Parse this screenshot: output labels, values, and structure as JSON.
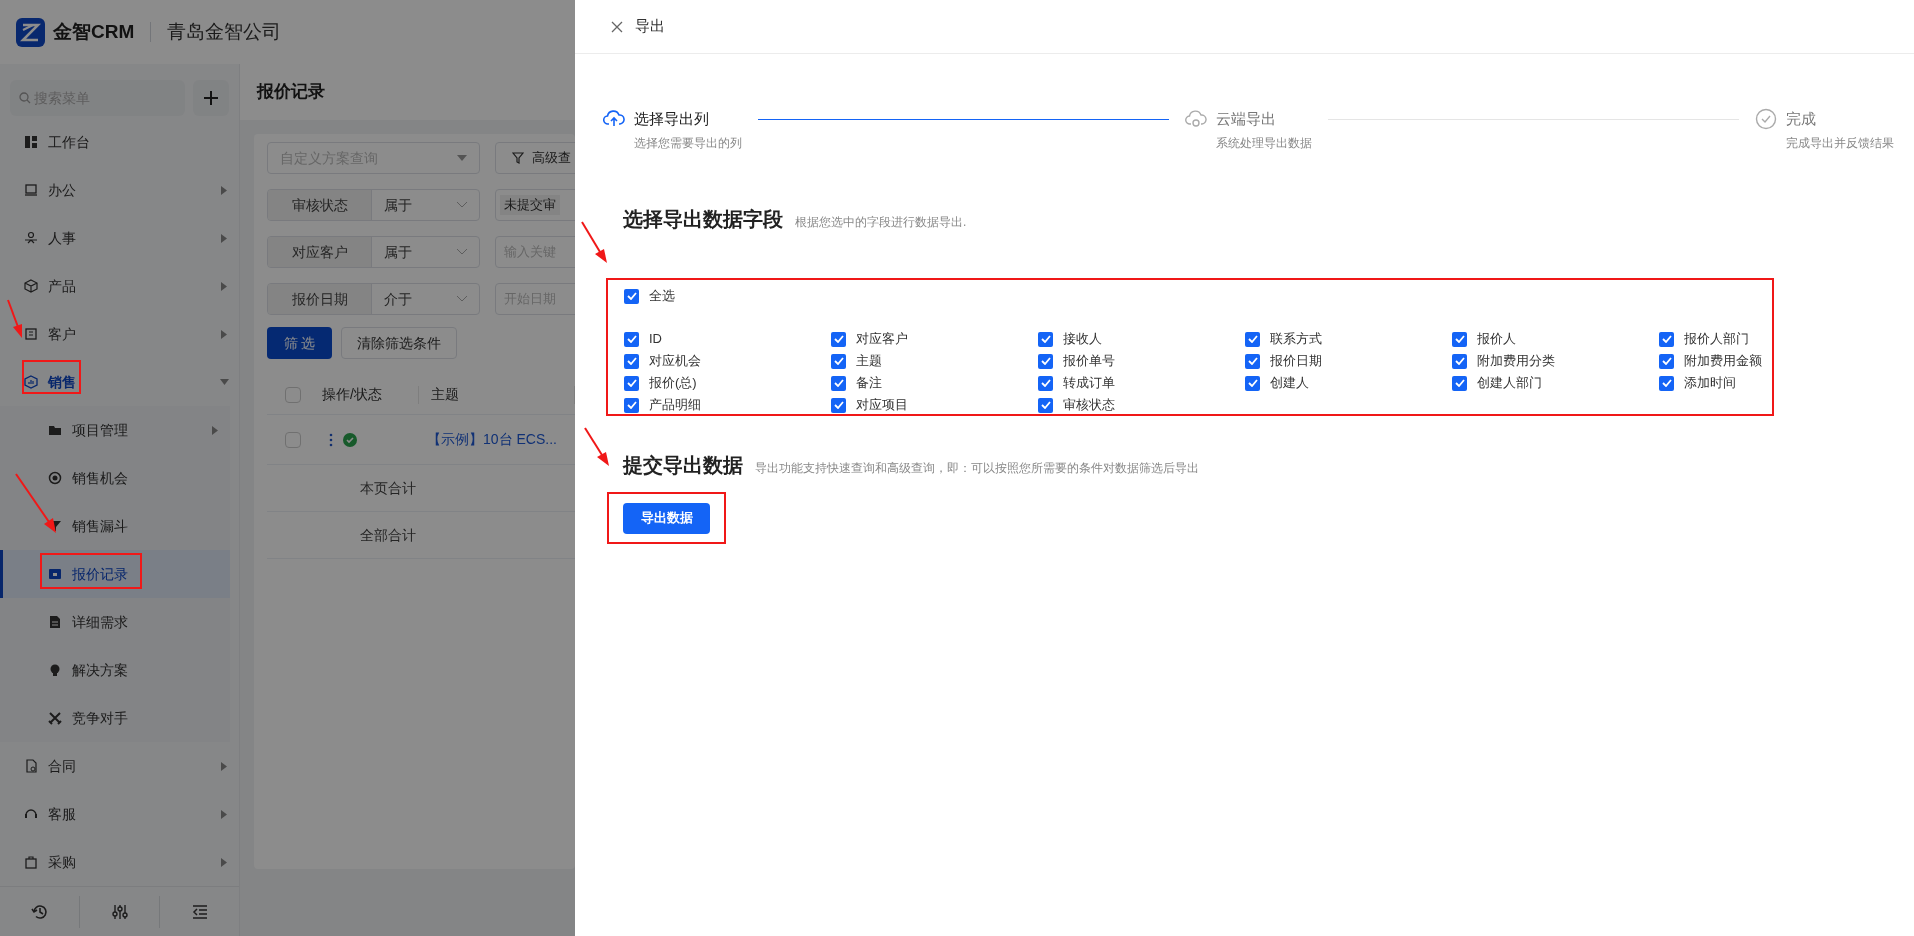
{
  "app": {
    "logo_text": "金智CRM",
    "company": "青岛金智公司"
  },
  "sidebar": {
    "search_placeholder": "搜索菜单",
    "items": [
      {
        "label": "工作台",
        "kind": "link",
        "selected": false
      },
      {
        "label": "办公",
        "kind": "menu",
        "expanded": false,
        "selected": false
      },
      {
        "label": "人事",
        "kind": "menu",
        "expanded": false,
        "selected": false
      },
      {
        "label": "产品",
        "kind": "menu",
        "expanded": false,
        "selected": false
      },
      {
        "label": "客户",
        "kind": "menu",
        "expanded": false,
        "selected": false
      },
      {
        "label": "销售",
        "kind": "menu",
        "expanded": true,
        "selected": true,
        "children": [
          {
            "label": "项目管理",
            "kind": "menu",
            "expanded": false,
            "selected": false
          },
          {
            "label": "销售机会",
            "kind": "link",
            "selected": false
          },
          {
            "label": "销售漏斗",
            "kind": "link",
            "selected": false
          },
          {
            "label": "报价记录",
            "kind": "link",
            "selected": true
          },
          {
            "label": "详细需求",
            "kind": "link",
            "selected": false
          },
          {
            "label": "解决方案",
            "kind": "link",
            "selected": false
          },
          {
            "label": "竞争对手",
            "kind": "link",
            "selected": false
          }
        ]
      },
      {
        "label": "合同",
        "kind": "menu",
        "expanded": false,
        "selected": false
      },
      {
        "label": "客服",
        "kind": "menu",
        "expanded": false,
        "selected": false
      },
      {
        "label": "采购",
        "kind": "menu",
        "expanded": false,
        "selected": false
      }
    ]
  },
  "main": {
    "title": "报价记录",
    "scheme_placeholder": "自定义方案查询",
    "advanced_button": "高级查",
    "filters": [
      {
        "field": "审核状态",
        "operator": "属于",
        "value": "未提交审"
      },
      {
        "field": "对应客户",
        "operator": "属于",
        "placeholder": "输入关键"
      },
      {
        "field": "报价日期",
        "operator": "介于",
        "placeholder": "开始日期"
      }
    ],
    "filter_button": "筛 选",
    "clear_button": "清除筛选条件",
    "table": {
      "all_checked": false,
      "columns": [
        "操作/状态",
        "主题"
      ],
      "rows": [
        {
          "checked": false,
          "approved": true,
          "subject": "【示例】10台 ECS..."
        }
      ],
      "summaries": [
        "本页合计",
        "全部合计"
      ]
    }
  },
  "drawer": {
    "title": "导出",
    "steps": [
      {
        "title": "选择导出列",
        "description": "选择您需要导出的列",
        "active": true
      },
      {
        "title": "云端导出",
        "description": "系统处理导出数据",
        "active": false
      },
      {
        "title": "完成",
        "description": "完成导出并反馈结果",
        "active": false
      }
    ],
    "fields_section": {
      "title": "选择导出数据字段",
      "hint": "根据您选中的字段进行数据导出.",
      "select_all": {
        "label": "全选",
        "checked": true
      },
      "fields": [
        {
          "label": "ID",
          "checked": true
        },
        {
          "label": "对应客户",
          "checked": true
        },
        {
          "label": "接收人",
          "checked": true
        },
        {
          "label": "联系方式",
          "checked": true
        },
        {
          "label": "报价人",
          "checked": true
        },
        {
          "label": "报价人部门",
          "checked": true
        },
        {
          "label": "对应机会",
          "checked": true
        },
        {
          "label": "主题",
          "checked": true
        },
        {
          "label": "报价单号",
          "checked": true
        },
        {
          "label": "报价日期",
          "checked": true
        },
        {
          "label": "附加费用分类",
          "checked": true
        },
        {
          "label": "附加费用金额",
          "checked": true
        },
        {
          "label": "报价(总)",
          "checked": true
        },
        {
          "label": "备注",
          "checked": true
        },
        {
          "label": "转成订单",
          "checked": true
        },
        {
          "label": "创建人",
          "checked": true
        },
        {
          "label": "创建人部门",
          "checked": true
        },
        {
          "label": "添加时间",
          "checked": true
        },
        {
          "label": "产品明细",
          "checked": true
        },
        {
          "label": "对应项目",
          "checked": true
        },
        {
          "label": "审核状态",
          "checked": true
        }
      ]
    },
    "submit_section": {
      "title": "提交导出数据",
      "hint": "导出功能支持快速查询和高级查询，即：可以按照您所需要的条件对数据筛选后导出",
      "button": "导出数据"
    }
  }
}
